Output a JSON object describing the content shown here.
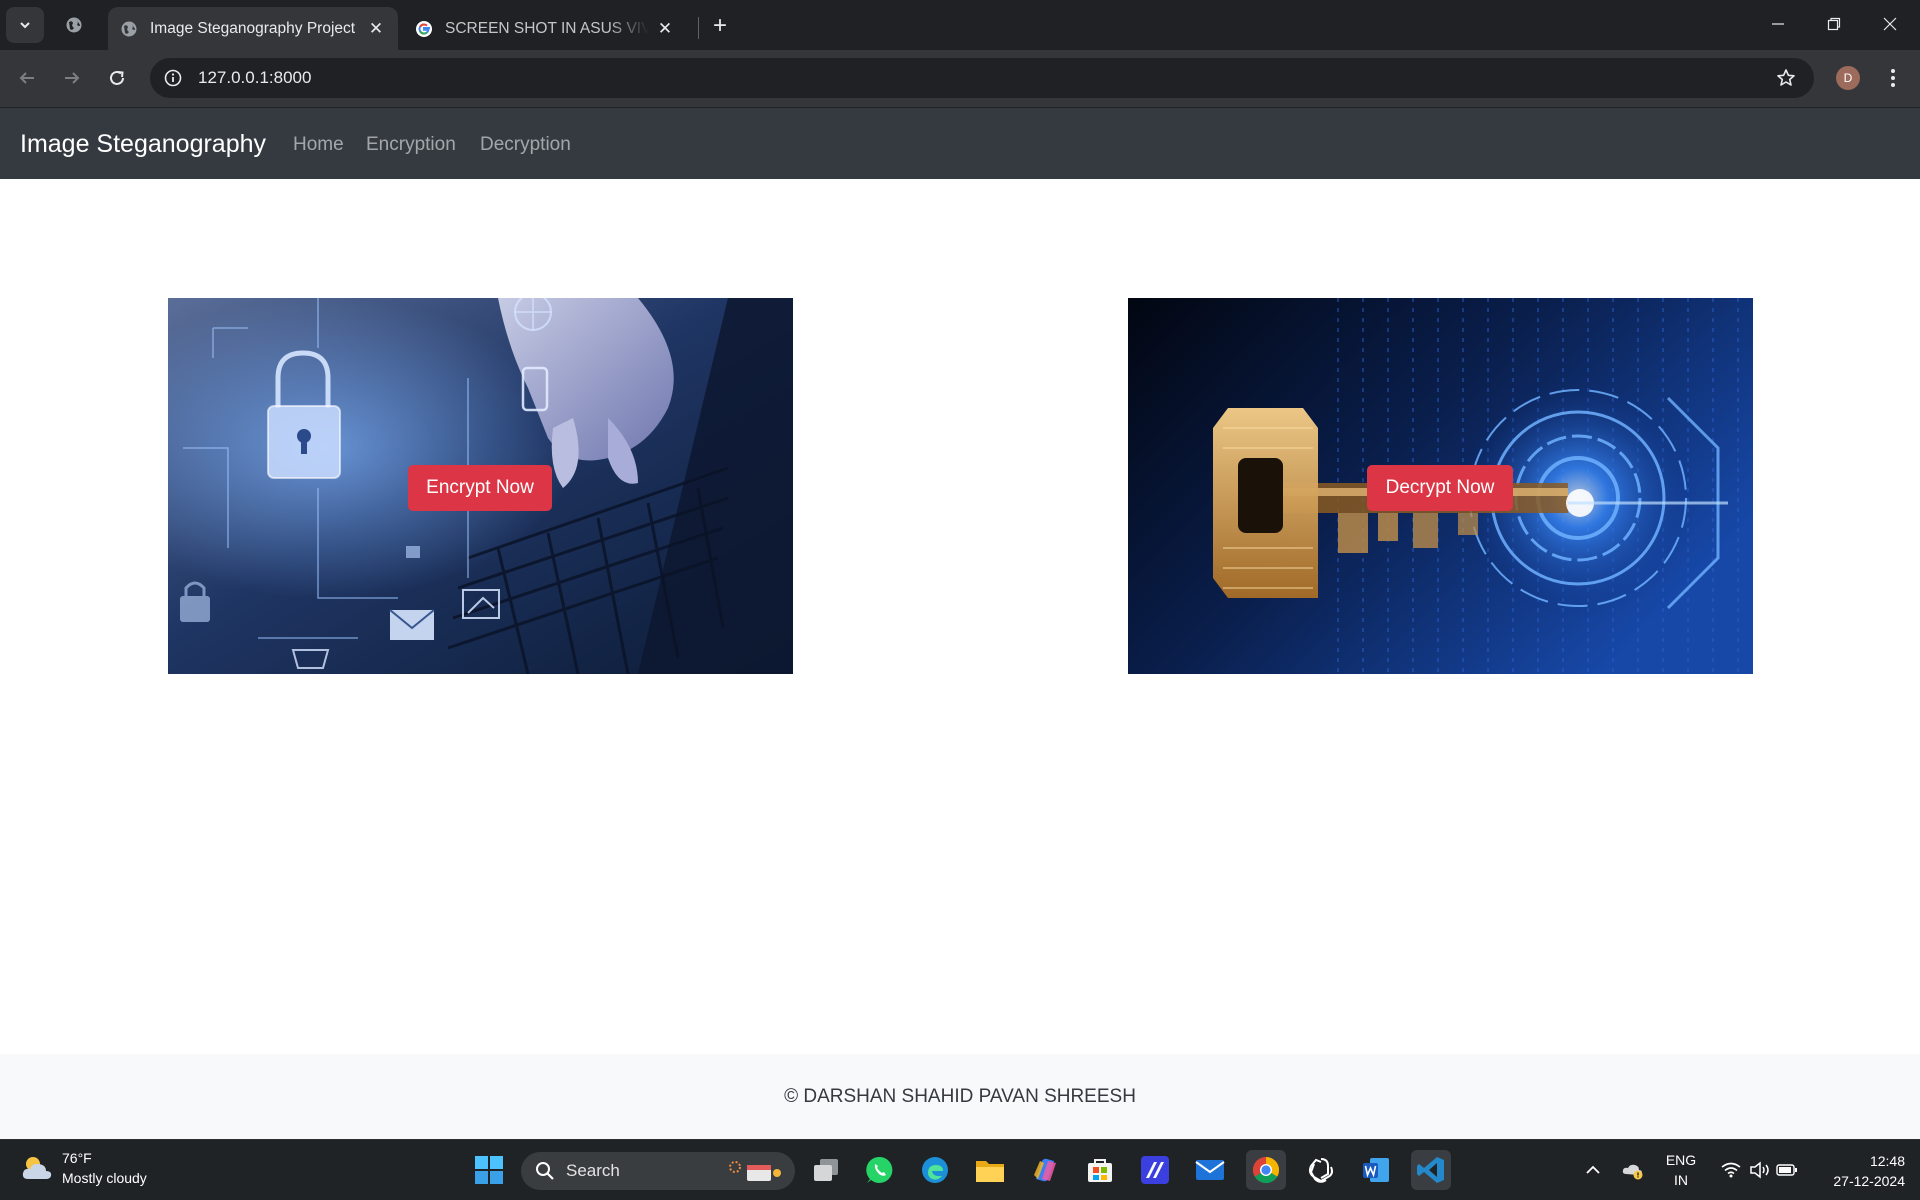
{
  "browser": {
    "tabs": [
      {
        "title": "Image Steganography Project",
        "active": true
      },
      {
        "title": "SCREEN SHOT IN ASUS VIVO BOOK",
        "active": false
      }
    ],
    "new_tab_label": "+",
    "address": "127.0.0.1:8000",
    "profile_initial": "D"
  },
  "site": {
    "brand": "Image Steganography",
    "nav": [
      "Home",
      "Encryption",
      "Decryption"
    ],
    "cards": [
      {
        "button": "Encrypt Now",
        "image": "encryption-lock-keyboard-image"
      },
      {
        "button": "Decrypt Now",
        "image": "digital-key-binary-image"
      }
    ],
    "footer": "© DARSHAN SHAHID PAVAN SHREESH",
    "colors": {
      "navbar": "#343a40",
      "button": "#dc3545",
      "footer_bg": "#f8f9fa"
    }
  },
  "taskbar": {
    "weather": {
      "temp": "76°F",
      "condition": "Mostly cloudy"
    },
    "search_placeholder": "Search",
    "apps": [
      "start-icon",
      "search",
      "task-view-icon",
      "whatsapp-icon",
      "edge-icon",
      "file-explorer-icon",
      "copilot-icon",
      "store-icon",
      "app-icon",
      "mail-icon",
      "chrome-icon",
      "chatgpt-icon",
      "word-icon",
      "vscode-icon"
    ],
    "language": {
      "line1": "ENG",
      "line2": "IN"
    },
    "clock": {
      "time": "12:48",
      "date": "27-12-2024"
    }
  }
}
